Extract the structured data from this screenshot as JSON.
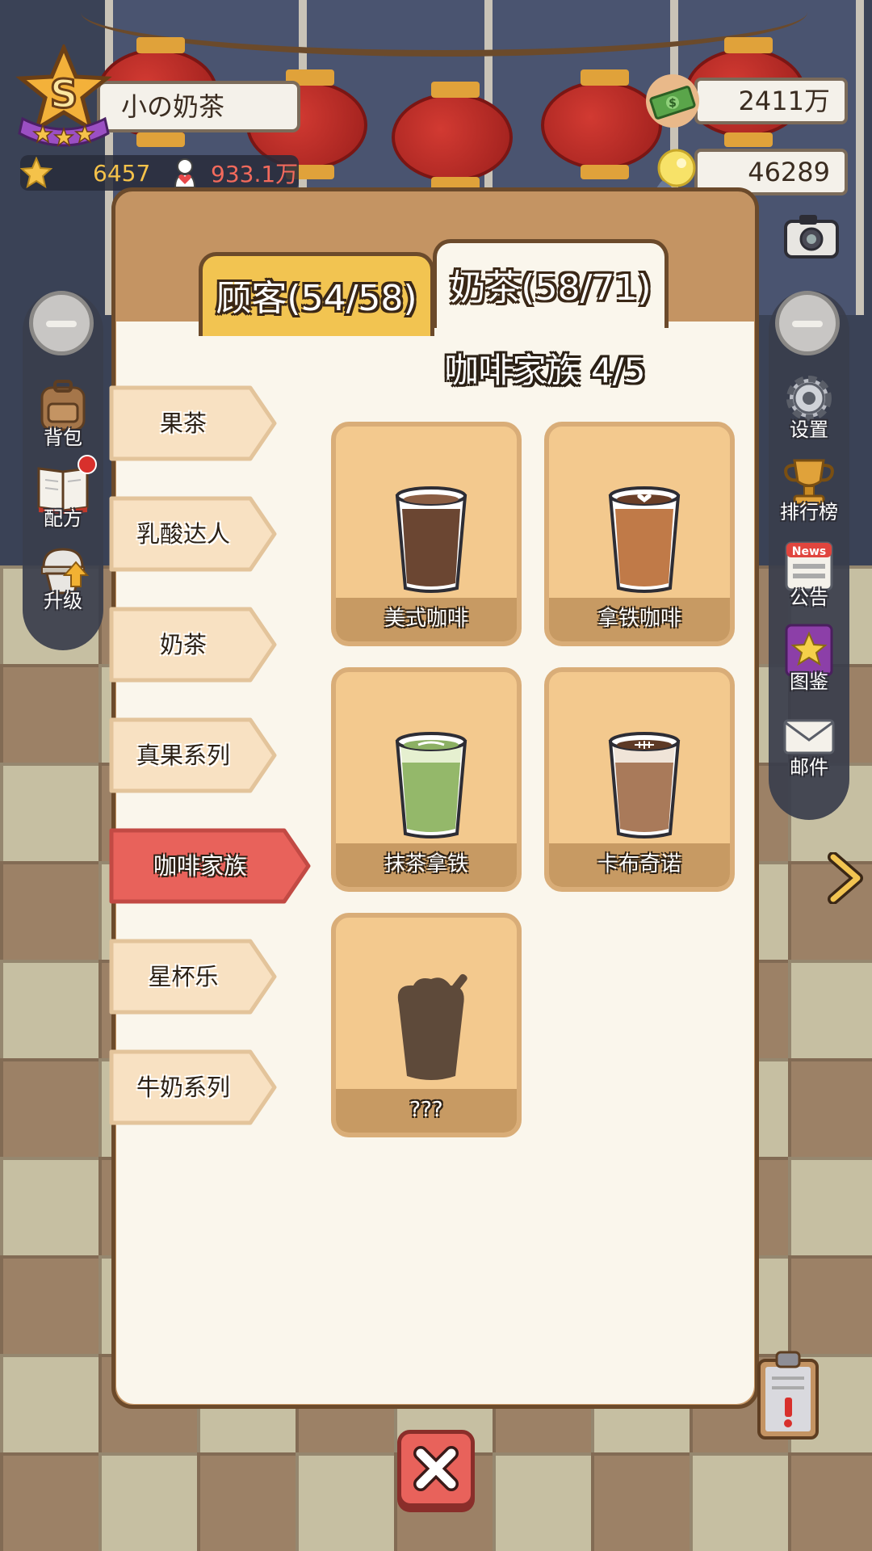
{
  "player": {
    "name": "小の奶茶",
    "rank": "S",
    "stars": "6457",
    "fans": "933.1万"
  },
  "currency": {
    "money": "2411万",
    "ideas": "46289"
  },
  "left_menu": [
    {
      "label": "背包",
      "icon": "backpack-icon"
    },
    {
      "label": "配方",
      "icon": "recipe-book-icon",
      "has_notification": true
    },
    {
      "label": "升级",
      "icon": "upgrade-icon"
    }
  ],
  "right_menu": [
    {
      "label": "设置",
      "icon": "gear-icon"
    },
    {
      "label": "排行榜",
      "icon": "trophy-icon"
    },
    {
      "label": "公告",
      "icon": "news-icon"
    },
    {
      "label": "图鉴",
      "icon": "collection-book-icon"
    },
    {
      "label": "邮件",
      "icon": "mail-icon"
    }
  ],
  "tabs": [
    {
      "label": "顾客(54/58)",
      "active": false
    },
    {
      "label": "奶茶(58/71)",
      "active": true
    }
  ],
  "section_title": "咖啡家族  4/5",
  "categories": [
    {
      "label": "果茶",
      "active": false
    },
    {
      "label": "乳酸达人",
      "active": false
    },
    {
      "label": "奶茶",
      "active": false
    },
    {
      "label": "真果系列",
      "active": false
    },
    {
      "label": "咖啡家族",
      "active": true
    },
    {
      "label": "星杯乐",
      "active": false
    },
    {
      "label": "牛奶系列",
      "active": false
    }
  ],
  "drinks": [
    {
      "name": "美式咖啡",
      "unlocked": true
    },
    {
      "name": "拿铁咖啡",
      "unlocked": true
    },
    {
      "name": "抹茶拿铁",
      "unlocked": true
    },
    {
      "name": "卡布奇诺",
      "unlocked": true
    },
    {
      "name": "???",
      "unlocked": false
    }
  ],
  "colors": {
    "active_category": "#e8625b",
    "inactive_category": "#f8e1c2",
    "tab_customer": "#f2c451",
    "panel_frame": "#c49463"
  }
}
